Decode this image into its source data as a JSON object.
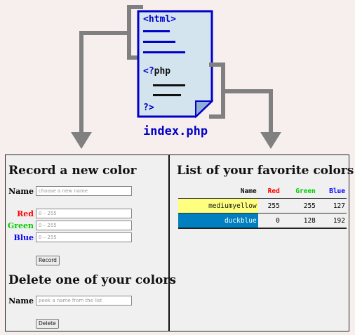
{
  "diagram": {
    "file_html": "<html>",
    "file_php_open": "<?php",
    "file_php_close": "?>",
    "filename": "index.php"
  },
  "record": {
    "heading": "Record a new color",
    "name_label": "Name",
    "name_placeholder": "choose a new name",
    "red_label": "Red",
    "green_label": "Green",
    "blue_label": "Blue",
    "range_placeholder": "0 – 255",
    "button": "Record"
  },
  "delete": {
    "heading": "Delete one of your colors",
    "name_label": "Name",
    "name_placeholder": "peek a name from the list",
    "button": "Delete"
  },
  "list": {
    "heading": "List of your favorite colors",
    "columns": [
      "Name",
      "Red",
      "Green",
      "Blue"
    ],
    "rows": [
      {
        "name": "mediumyellow",
        "red": "255",
        "green": "255",
        "blue": "127",
        "swatch": "#ffff7f",
        "text_color": "#111111"
      },
      {
        "name": "duckblue",
        "red": "0",
        "green": "128",
        "blue": "192",
        "swatch": "#0080c0",
        "text_color": "#ffffff"
      }
    ]
  },
  "colors": {
    "red": "#ff0000",
    "green": "#00cc00",
    "blue": "#0000ff",
    "doc_fill": "#d3e4ee",
    "doc_stroke": "#0000c8",
    "bracket": "#808080",
    "panel_bg": "#f0f0f0"
  }
}
